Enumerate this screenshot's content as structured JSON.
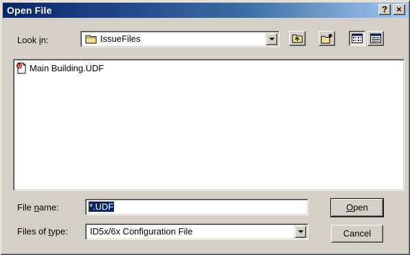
{
  "window": {
    "title": "Open File",
    "help_label": "?",
    "close_label": "×"
  },
  "look_in": {
    "label_prefix": "Look ",
    "label_accel": "i",
    "label_suffix": "n:",
    "value": "IssueFiles",
    "icon": "folder-icon"
  },
  "toolbar": {
    "up_icon": "up-one-level-icon",
    "new_folder_icon": "new-folder-icon",
    "list_view_icon": "list-view-icon",
    "details_view_icon": "details-view-icon"
  },
  "files": [
    {
      "name": "Main Building.UDF",
      "icon": "udf-file-icon"
    }
  ],
  "file_name": {
    "label_prefix": "File ",
    "label_accel": "n",
    "label_suffix": "ame:",
    "value": "*.UDF"
  },
  "file_type": {
    "label_prefix": "Files of ",
    "label_accel": "t",
    "label_suffix": "ype:",
    "value": "ID5x/6x Configuration File"
  },
  "buttons": {
    "open_accel": "O",
    "open_rest": "pen",
    "cancel": "Cancel"
  },
  "colors": {
    "titlebar_start": "#0a246a",
    "titlebar_end": "#a6caf0",
    "face": "#d4d0c8",
    "selection": "#0a246a"
  }
}
